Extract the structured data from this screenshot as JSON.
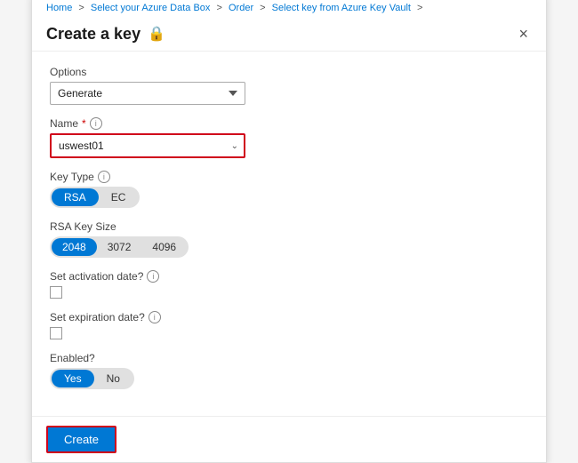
{
  "breadcrumb": {
    "items": [
      {
        "label": "Home",
        "href": "#"
      },
      {
        "label": "Select your Azure Data Box",
        "href": "#"
      },
      {
        "label": "Order",
        "href": "#"
      },
      {
        "label": "Select key from Azure Key Vault",
        "href": "#"
      }
    ],
    "separators": [
      ">",
      ">",
      ">"
    ]
  },
  "dialog": {
    "title": "Create a key",
    "title_icon": "🔒",
    "close_label": "×",
    "options_label": "Options",
    "options_value": "Generate",
    "options_placeholder": "Generate",
    "name_label": "Name",
    "name_required": "*",
    "name_value": "uswest01",
    "key_type_label": "Key Type",
    "key_type_options": [
      "RSA",
      "EC"
    ],
    "key_type_selected": "RSA",
    "rsa_key_size_label": "RSA Key Size",
    "rsa_key_sizes": [
      "2048",
      "3072",
      "4096"
    ],
    "rsa_key_size_selected": "2048",
    "activation_date_label": "Set activation date?",
    "expiration_date_label": "Set expiration date?",
    "enabled_label": "Enabled?",
    "enabled_options": [
      "Yes",
      "No"
    ],
    "enabled_selected": "Yes",
    "create_button_label": "Create"
  }
}
